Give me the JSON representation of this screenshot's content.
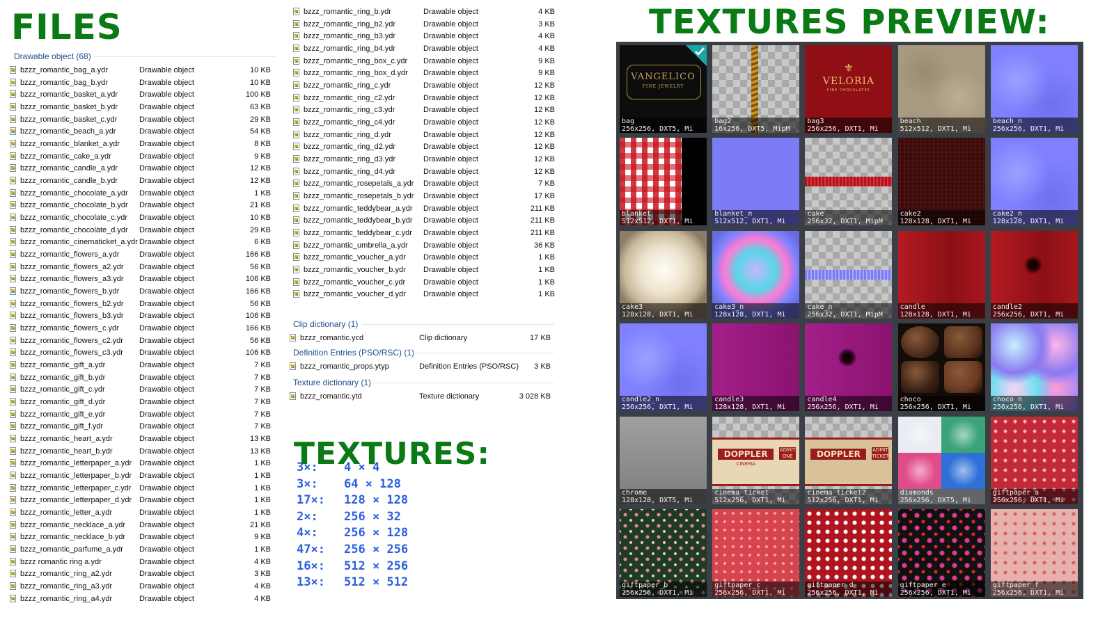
{
  "titles": {
    "files": "FILES",
    "preview": "TEXTURES PREVIEW:",
    "textures": "TEXTURES:"
  },
  "groups": {
    "drawable": "Drawable object (68)",
    "clip": "Clip dictionary (1)",
    "definition": "Definition Entries (PSO/RSC) (1)",
    "texture": "Texture dictionary (1)"
  },
  "list1": [
    {
      "name": "bzzz_romantic_bag_a.ydr",
      "type": "Drawable object",
      "size": "10 KB"
    },
    {
      "name": "bzzz_romantic_bag_b.ydr",
      "type": "Drawable object",
      "size": "10 KB"
    },
    {
      "name": "bzzz_romantic_basket_a.ydr",
      "type": "Drawable object",
      "size": "100 KB"
    },
    {
      "name": "bzzz_romantic_basket_b.ydr",
      "type": "Drawable object",
      "size": "63 KB"
    },
    {
      "name": "bzzz_romantic_basket_c.ydr",
      "type": "Drawable object",
      "size": "29 KB"
    },
    {
      "name": "bzzz_romantic_beach_a.ydr",
      "type": "Drawable object",
      "size": "54 KB"
    },
    {
      "name": "bzzz_romantic_blanket_a.ydr",
      "type": "Drawable object",
      "size": "8 KB"
    },
    {
      "name": "bzzz_romantic_cake_a.ydr",
      "type": "Drawable object",
      "size": "9 KB"
    },
    {
      "name": "bzzz_romantic_candle_a.ydr",
      "type": "Drawable object",
      "size": "12 KB"
    },
    {
      "name": "bzzz_romantic_candle_b.ydr",
      "type": "Drawable object",
      "size": "12 KB"
    },
    {
      "name": "bzzz_romantic_chocolate_a.ydr",
      "type": "Drawable object",
      "size": "1 KB"
    },
    {
      "name": "bzzz_romantic_chocolate_b.ydr",
      "type": "Drawable object",
      "size": "21 KB"
    },
    {
      "name": "bzzz_romantic_chocolate_c.ydr",
      "type": "Drawable object",
      "size": "10 KB"
    },
    {
      "name": "bzzz_romantic_chocolate_d.ydr",
      "type": "Drawable object",
      "size": "29 KB"
    },
    {
      "name": "bzzz_romantic_cinematicket_a.ydr",
      "type": "Drawable object",
      "size": "6 KB"
    },
    {
      "name": "bzzz_romantic_flowers_a.ydr",
      "type": "Drawable object",
      "size": "166 KB"
    },
    {
      "name": "bzzz_romantic_flowers_a2.ydr",
      "type": "Drawable object",
      "size": "56 KB"
    },
    {
      "name": "bzzz_romantic_flowers_a3.ydr",
      "type": "Drawable object",
      "size": "106 KB"
    },
    {
      "name": "bzzz_romantic_flowers_b.ydr",
      "type": "Drawable object",
      "size": "166 KB"
    },
    {
      "name": "bzzz_romantic_flowers_b2.ydr",
      "type": "Drawable object",
      "size": "56 KB"
    },
    {
      "name": "bzzz_romantic_flowers_b3.ydr",
      "type": "Drawable object",
      "size": "106 KB"
    },
    {
      "name": "bzzz_romantic_flowers_c.ydr",
      "type": "Drawable object",
      "size": "166 KB"
    },
    {
      "name": "bzzz_romantic_flowers_c2.ydr",
      "type": "Drawable object",
      "size": "56 KB"
    },
    {
      "name": "bzzz_romantic_flowers_c3.ydr",
      "type": "Drawable object",
      "size": "106 KB"
    },
    {
      "name": "bzzz_romantic_gift_a.ydr",
      "type": "Drawable object",
      "size": "7 KB"
    },
    {
      "name": "bzzz_romantic_gift_b.ydr",
      "type": "Drawable object",
      "size": "7 KB"
    },
    {
      "name": "bzzz_romantic_gift_c.ydr",
      "type": "Drawable object",
      "size": "7 KB"
    },
    {
      "name": "bzzz_romantic_gift_d.ydr",
      "type": "Drawable object",
      "size": "7 KB"
    },
    {
      "name": "bzzz_romantic_gift_e.ydr",
      "type": "Drawable object",
      "size": "7 KB"
    },
    {
      "name": "bzzz_romantic_gift_f.ydr",
      "type": "Drawable object",
      "size": "7 KB"
    },
    {
      "name": "bzzz_romantic_heart_a.ydr",
      "type": "Drawable object",
      "size": "13 KB"
    },
    {
      "name": "bzzz_romantic_heart_b.ydr",
      "type": "Drawable object",
      "size": "13 KB"
    },
    {
      "name": "bzzz_romantic_letterpaper_a.ydr",
      "type": "Drawable object",
      "size": "1 KB"
    },
    {
      "name": "bzzz_romantic_letterpaper_b.ydr",
      "type": "Drawable object",
      "size": "1 KB"
    },
    {
      "name": "bzzz_romantic_letterpaper_c.ydr",
      "type": "Drawable object",
      "size": "1 KB"
    },
    {
      "name": "bzzz_romantic_letterpaper_d.ydr",
      "type": "Drawable object",
      "size": "1 KB"
    },
    {
      "name": "bzzz_romantic_letter_a.ydr",
      "type": "Drawable object",
      "size": "1 KB"
    },
    {
      "name": "bzzz_romantic_necklace_a.ydr",
      "type": "Drawable object",
      "size": "21 KB"
    },
    {
      "name": "bzzz_romantic_necklace_b.ydr",
      "type": "Drawable object",
      "size": "9 KB"
    },
    {
      "name": "bzzz_romantic_parfume_a.ydr",
      "type": "Drawable object",
      "size": "1 KB"
    },
    {
      "name": "bzzz romantic ring a.ydr",
      "type": "Drawable object",
      "size": "4 KB"
    },
    {
      "name": "bzzz_romantic_ring_a2.ydr",
      "type": "Drawable object",
      "size": "3 KB"
    },
    {
      "name": "bzzz_romantic_ring_a3.ydr",
      "type": "Drawable object",
      "size": "4 KB"
    },
    {
      "name": "bzzz_romantic_ring_a4.ydr",
      "type": "Drawable object",
      "size": "4 KB"
    }
  ],
  "list2": [
    {
      "name": "bzzz_romantic_ring_b.ydr",
      "type": "Drawable object",
      "size": "4 KB"
    },
    {
      "name": "bzzz_romantic_ring_b2.ydr",
      "type": "Drawable object",
      "size": "3 KB"
    },
    {
      "name": "bzzz_romantic_ring_b3.ydr",
      "type": "Drawable object",
      "size": "4 KB"
    },
    {
      "name": "bzzz_romantic_ring_b4.ydr",
      "type": "Drawable object",
      "size": "4 KB"
    },
    {
      "name": "bzzz_romantic_ring_box_c.ydr",
      "type": "Drawable object",
      "size": "9 KB"
    },
    {
      "name": "bzzz_romantic_ring_box_d.ydr",
      "type": "Drawable object",
      "size": "9 KB"
    },
    {
      "name": "bzzz_romantic_ring_c.ydr",
      "type": "Drawable object",
      "size": "12 KB"
    },
    {
      "name": "bzzz_romantic_ring_c2.ydr",
      "type": "Drawable object",
      "size": "12 KB"
    },
    {
      "name": "bzzz_romantic_ring_c3.ydr",
      "type": "Drawable object",
      "size": "12 KB"
    },
    {
      "name": "bzzz_romantic_ring_c4.ydr",
      "type": "Drawable object",
      "size": "12 KB"
    },
    {
      "name": "bzzz_romantic_ring_d.ydr",
      "type": "Drawable object",
      "size": "12 KB"
    },
    {
      "name": "bzzz_romantic_ring_d2.ydr",
      "type": "Drawable object",
      "size": "12 KB"
    },
    {
      "name": "bzzz_romantic_ring_d3.ydr",
      "type": "Drawable object",
      "size": "12 KB"
    },
    {
      "name": "bzzz_romantic_ring_d4.ydr",
      "type": "Drawable object",
      "size": "12 KB"
    },
    {
      "name": "bzzz_romantic_rosepetals_a.ydr",
      "type": "Drawable object",
      "size": "7 KB"
    },
    {
      "name": "bzzz_romantic_rosepetals_b.ydr",
      "type": "Drawable object",
      "size": "17 KB"
    },
    {
      "name": "bzzz_romantic_teddybear_a.ydr",
      "type": "Drawable object",
      "size": "211 KB"
    },
    {
      "name": "bzzz_romantic_teddybear_b.ydr",
      "type": "Drawable object",
      "size": "211 KB"
    },
    {
      "name": "bzzz_romantic_teddybear_c.ydr",
      "type": "Drawable object",
      "size": "211 KB"
    },
    {
      "name": "bzzz_romantic_umbrella_a.ydr",
      "type": "Drawable object",
      "size": "36 KB"
    },
    {
      "name": "bzzz_romantic_voucher_a.ydr",
      "type": "Drawable object",
      "size": "1 KB"
    },
    {
      "name": "bzzz_romantic_voucher_b.ydr",
      "type": "Drawable object",
      "size": "1 KB"
    },
    {
      "name": "bzzz_romantic_voucher_c.ydr",
      "type": "Drawable object",
      "size": "1 KB"
    },
    {
      "name": "bzzz_romantic_voucher_d.ydr",
      "type": "Drawable object",
      "size": "1 KB"
    }
  ],
  "other_files": [
    {
      "name": "bzzz_romantic.ycd",
      "type": "Clip dictionary",
      "size": "17 KB"
    },
    {
      "name": "bzzz_romantic_props.ytyp",
      "type": "Definition Entries (PSO/RSC)",
      "size": "3 KB"
    },
    {
      "name": "bzzz_romantic.ytd",
      "type": "Texture dictionary",
      "size": "3 028 KB"
    }
  ],
  "texture_stats": [
    {
      "count": "3×:",
      "dims": "4 × 4"
    },
    {
      "count": "3×:",
      "dims": "64 × 128"
    },
    {
      "count": "17×:",
      "dims": "128 × 128"
    },
    {
      "count": "2×:",
      "dims": "256 × 32"
    },
    {
      "count": "4×:",
      "dims": "256 × 128"
    },
    {
      "count": "47×:",
      "dims": "256 × 256"
    },
    {
      "count": "16×:",
      "dims": "512 × 256"
    },
    {
      "count": "13×:",
      "dims": "512 × 512"
    }
  ],
  "tiles": [
    {
      "name": "bag",
      "info": "256x256, DXT5, Mi",
      "style": "bag",
      "selected": true
    },
    {
      "name": "bag2",
      "info": "16x256, DXT5, MipM",
      "style": "bag2"
    },
    {
      "name": "bag3",
      "info": "256x256, DXT1, Mi",
      "style": "bag3"
    },
    {
      "name": "beach",
      "info": "512x512, DXT1, Mi",
      "style": "beach"
    },
    {
      "name": "beach_n",
      "info": "256x256, DXT1, Mi",
      "style": "normal"
    },
    {
      "name": "blanket",
      "info": "512x512, DXT1, Mi",
      "style": "blanket"
    },
    {
      "name": "blanket_n",
      "info": "512x512, DXT1, Mi",
      "style": "normal-dark"
    },
    {
      "name": "cake",
      "info": "256x32, DXT1, MipM",
      "style": "cake"
    },
    {
      "name": "cake2",
      "info": "128x128, DXT1, Mi",
      "style": "cake2"
    },
    {
      "name": "cake2_n",
      "info": "128x128, DXT1, Mi",
      "style": "normal"
    },
    {
      "name": "cake3",
      "info": "128x128, DXT1, Mi",
      "style": "cream"
    },
    {
      "name": "cake3_n",
      "info": "128x128, DXT1, Mi",
      "style": "cream-n"
    },
    {
      "name": "cake_n",
      "info": "256x32, DXT1, MipM",
      "style": "cake-n"
    },
    {
      "name": "candle",
      "info": "128x128, DXT1, Mi",
      "style": "red"
    },
    {
      "name": "candle2",
      "info": "256x256, DXT1, Mi",
      "style": "candle2"
    },
    {
      "name": "candle2_n",
      "info": "256x256, DXT1, Mi",
      "style": "normal"
    },
    {
      "name": "candle3",
      "info": "128x128, DXT1, Mi",
      "style": "magenta"
    },
    {
      "name": "candle4",
      "info": "256x256, DXT1, Mi",
      "style": "candle4"
    },
    {
      "name": "choco",
      "info": "256x256, DXT1, Mi",
      "style": "choco"
    },
    {
      "name": "choco_n",
      "info": "256x256, DXT1, Mi",
      "style": "choco-n"
    },
    {
      "name": "chrome",
      "info": "128x128, DXT5, Mi",
      "style": "chrome"
    },
    {
      "name": "cinema_ticket",
      "info": "512x256, DXT1, Mi",
      "style": "ticket"
    },
    {
      "name": "cinema_ticket2",
      "info": "512x256, DXT1, Mi",
      "style": "ticket2"
    },
    {
      "name": "diamonds",
      "info": "256x256, DXT5, Mi",
      "style": "diam"
    },
    {
      "name": "giftpaper_a",
      "info": "256x256, DXT1, Mi",
      "style": "gift-a"
    },
    {
      "name": "giftpaper_b",
      "info": "256x256, DXT1, Mi",
      "style": "gift-b"
    },
    {
      "name": "giftpaper_c",
      "info": "256x256, DXT1, Mi",
      "style": "gift-c"
    },
    {
      "name": "giftpaper_d",
      "info": "256x256, DXT1, Mi",
      "style": "gift-d"
    },
    {
      "name": "giftpaper_e",
      "info": "256x256, DXT1, Mi",
      "style": "gift-e"
    },
    {
      "name": "giftpaper_f",
      "info": "256x256, DXT1, Mi",
      "style": "gift-f"
    }
  ],
  "tile_art": {
    "bag_logo": "VANGELICO",
    "bag_sub": "FINE JEWELRY",
    "bag3_logo": "VELORIA",
    "bag3_sub": "FINE CHOCOLATES",
    "ticket_logo": "DOPPLER",
    "ticket_sub": "CINEMA",
    "ticket_admit": "ADMIT ONE",
    "ticket2_logo": "DOPPLER",
    "ticket2_admit": "ADMIT TICKET"
  },
  "colors": {
    "title_green": "#0a7a14",
    "group_blue": "#1e4e8c",
    "stat_blue": "#2c5fe0",
    "preview_bg": "#3a3f45",
    "selected_check": "#1aa6a6"
  }
}
